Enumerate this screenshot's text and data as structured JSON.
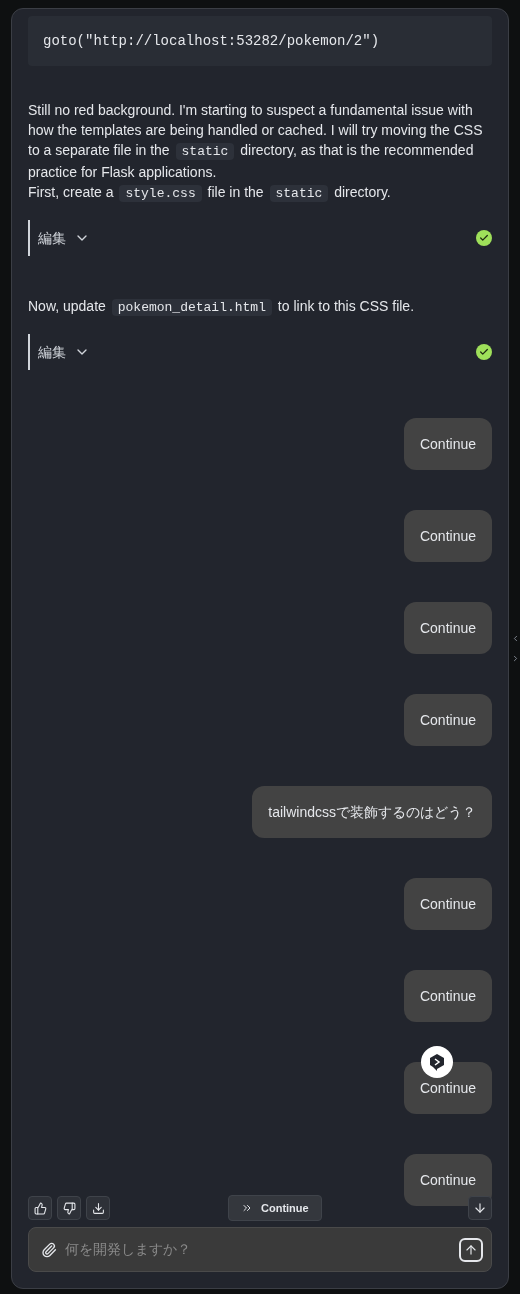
{
  "messages": [
    {
      "kind": "code",
      "text": "goto(\"http://localhost:53282/pokemon/2\")"
    },
    {
      "kind": "paragraph",
      "lines": [
        [
          {
            "kind": "text",
            "text": "Still no red background. I'm starting to suspect a fundamental issue with how the templates are being handled or cached. I will try moving the CSS to a separate file in the "
          },
          {
            "kind": "code",
            "text": "static"
          },
          {
            "kind": "text",
            "text": " directory, as that is the recommended practice for Flask applications."
          }
        ],
        [
          {
            "kind": "text",
            "text": "First, create a "
          },
          {
            "kind": "code",
            "text": "style.css"
          },
          {
            "kind": "text",
            "text": " file in the "
          },
          {
            "kind": "code",
            "text": "static"
          },
          {
            "kind": "text",
            "text": " directory."
          }
        ]
      ]
    },
    {
      "kind": "edit",
      "label": "編集",
      "done": true
    },
    {
      "kind": "paragraph",
      "lines": [
        [
          {
            "kind": "text",
            "text": "Now, update "
          },
          {
            "kind": "code",
            "text": "pokemon_detail.html"
          },
          {
            "kind": "text",
            "text": " to link to this CSS file."
          }
        ]
      ]
    },
    {
      "kind": "edit",
      "label": "編集",
      "done": true
    },
    {
      "kind": "user",
      "text": "Continue"
    },
    {
      "kind": "user",
      "text": "Continue"
    },
    {
      "kind": "user",
      "text": "Continue"
    },
    {
      "kind": "user",
      "text": "Continue"
    },
    {
      "kind": "user",
      "text": "tailwindcssで装飾するのはどう？"
    },
    {
      "kind": "user",
      "text": "Continue"
    },
    {
      "kind": "user",
      "text": "Continue"
    },
    {
      "kind": "user",
      "text": "Continue"
    },
    {
      "kind": "user",
      "text": "Continue"
    }
  ],
  "continue_button": {
    "label": "Continue"
  },
  "input": {
    "placeholder": "何を開発しますか？"
  }
}
